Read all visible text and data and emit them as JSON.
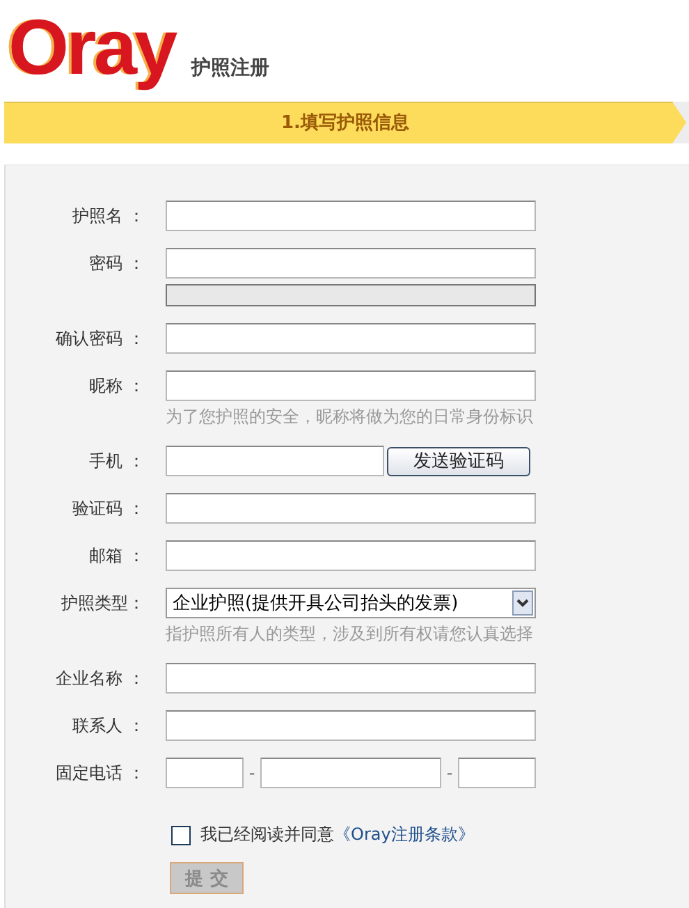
{
  "logo": "Oray",
  "title": "护照注册",
  "step": "1.填写护照信息",
  "fields": [
    {
      "kind": "text",
      "label": "护照名 ："
    },
    {
      "kind": "password",
      "label": "密码 ：",
      "strength": {
        "level": 0
      }
    },
    {
      "kind": "text",
      "label": "确认密码 ："
    },
    {
      "kind": "text",
      "label": "昵称 ：",
      "hint": "为了您护照的安全，昵称将做为您的日常身份标识"
    },
    {
      "kind": "phone",
      "label": "手机 ：",
      "button": "发送验证码"
    },
    {
      "kind": "text",
      "label": "验证码 ："
    },
    {
      "kind": "text",
      "label": "邮箱 ："
    },
    {
      "kind": "select",
      "label": "护照类型：",
      "value": "企业护照(提供开具公司抬头的发票)",
      "hint": "指护照所有人的类型，涉及到所有权请您认真选择"
    },
    {
      "kind": "text",
      "label": "企业名称 ："
    },
    {
      "kind": "text",
      "label": "联系人 ："
    },
    {
      "kind": "tel",
      "label": "固定电话 ：",
      "separators": [
        "-",
        "-"
      ]
    }
  ],
  "agreement": {
    "checked": false,
    "text": "我已经阅读并同意",
    "link": "《Oray注册条款》"
  },
  "submit": {
    "label": "提 交",
    "disabled": true
  }
}
